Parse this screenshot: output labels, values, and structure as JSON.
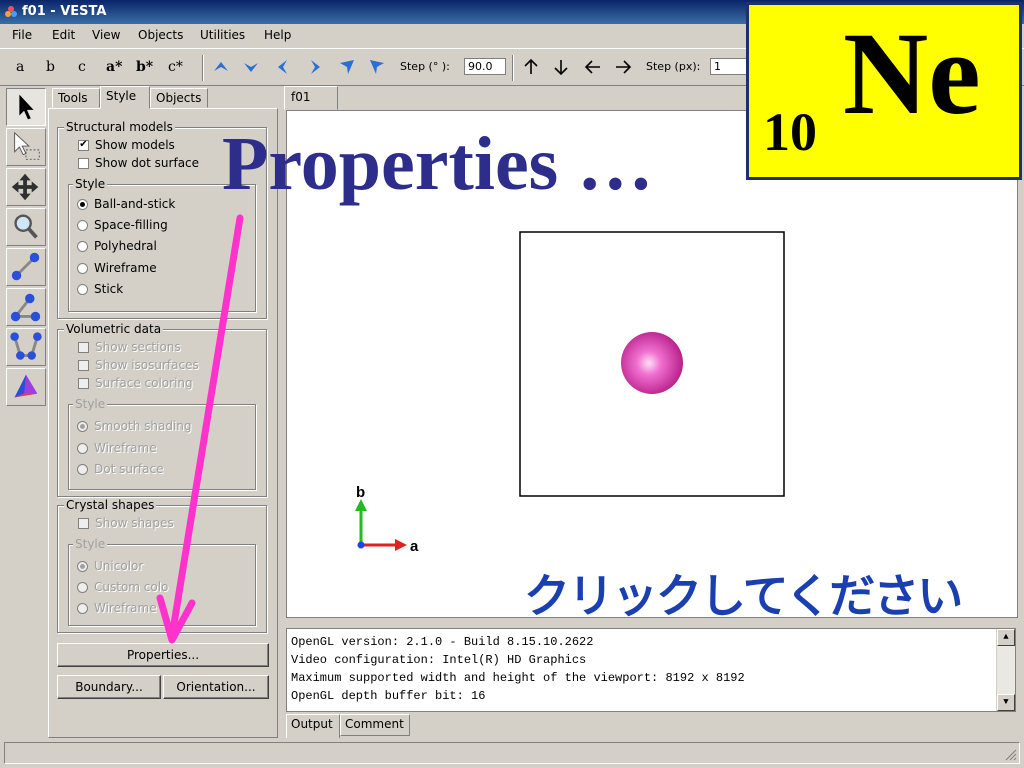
{
  "window": {
    "title": "f01 - VESTA"
  },
  "menu": [
    "File",
    "Edit",
    "View",
    "Objects",
    "Utilities",
    "Help"
  ],
  "toolbar": {
    "axis_letters": [
      "a",
      "b",
      "c",
      "a*",
      "b*",
      "c*"
    ],
    "rotate_icons": [
      "arrow-up-icon",
      "arrow-down-icon",
      "arrow-left-icon",
      "arrow-right-icon",
      "rotate-ccw-icon",
      "rotate-cw-icon"
    ],
    "step_deg_label": "Step (° ):",
    "step_deg_value": "90.0",
    "step_px_label": "Step (px):",
    "step_px_value": "1"
  },
  "tools": [
    "select-icon",
    "select-region-icon",
    "translate-icon",
    "magnify-icon",
    "distance-icon",
    "angle-icon",
    "dihedral-icon",
    "boundary-icon"
  ],
  "panel": {
    "tabs": [
      "Tools",
      "Style",
      "Objects"
    ],
    "active_tab": "Style",
    "structural": {
      "title": "Structural models",
      "show_models": "Show models",
      "show_dot_surface": "Show dot surface",
      "style_title": "Style",
      "styles": [
        "Ball-and-stick",
        "Space-filling",
        "Polyhedral",
        "Wireframe",
        "Stick"
      ]
    },
    "volumetric": {
      "title": "Volumetric data",
      "show_sections": "Show sections",
      "show_isosurfaces": "Show isosurfaces",
      "surface_coloring": "Surface coloring",
      "style_title": "Style",
      "styles": [
        "Smooth shading",
        "Wireframe",
        "Dot surface"
      ]
    },
    "crystal": {
      "title": "Crystal shapes",
      "show_shapes": "Show shapes",
      "style_title": "Style",
      "styles": [
        "Unicolor",
        "Custom colo",
        "Wireframe"
      ]
    },
    "buttons": {
      "properties": "Properties...",
      "boundary": "Boundary...",
      "orientation": "Orientation..."
    }
  },
  "viewport": {
    "tab": "f01",
    "axis_b": "b",
    "axis_a": "a",
    "atom_color": "#e040b0"
  },
  "output": {
    "lines": [
      "OpenGL version: 2.1.0 - Build 8.15.10.2622",
      "Video configuration: Intel(R) HD Graphics",
      "Maximum supported width and height of the viewport: 8192 x 8192",
      "OpenGL depth buffer bit: 16"
    ],
    "tabs": [
      "Output",
      "Comment"
    ]
  },
  "overlay": {
    "element_number": "10",
    "element_symbol": "Ne",
    "properties_text": "Properties …",
    "instruction": "クリックしてください",
    "arrow_color": "#ff33cc"
  }
}
